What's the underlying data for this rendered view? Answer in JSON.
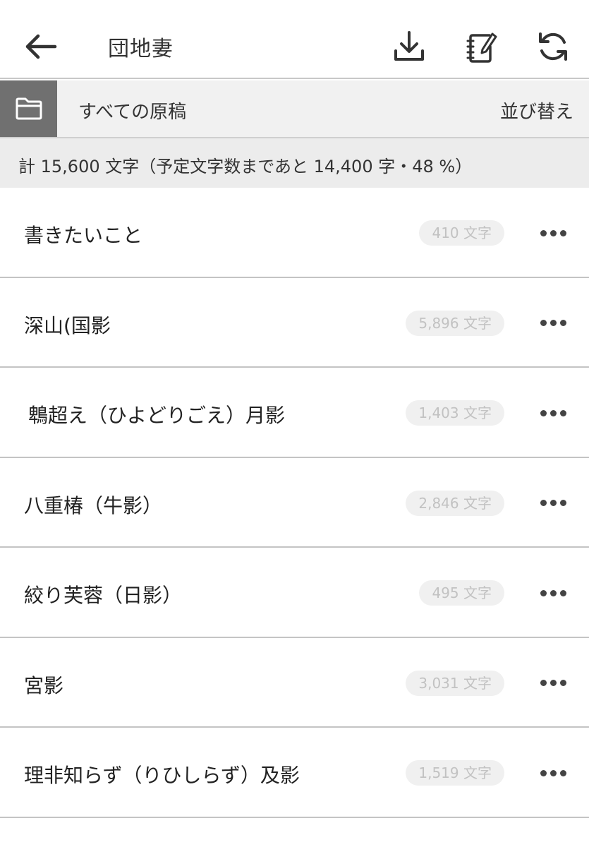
{
  "header": {
    "title": "団地妻",
    "back_icon": "arrow-left-icon",
    "download_icon": "download-icon",
    "notebook_icon": "notebook-edit-icon",
    "sync_icon": "sync-icon"
  },
  "folder_bar": {
    "icon": "folder-icon",
    "label": "すべての原稿",
    "sort_label": "並び替え"
  },
  "summary": {
    "text": "計 15,600 文字（予定文字数まであと 14,400 字・48 %）"
  },
  "manuscripts": [
    {
      "title": "書きたいこと",
      "count": "410 文字"
    },
    {
      "title": "深山(国影",
      "count": "5,896 文字"
    },
    {
      "title": "鵯超え（ひよどりごえ）月影",
      "count": "1,403 文字"
    },
    {
      "title": "八重椿（牛影）",
      "count": "2,846 文字"
    },
    {
      "title": "絞り芙蓉（日影）",
      "count": "495 文字"
    },
    {
      "title": "宮影",
      "count": "3,031 文字"
    },
    {
      "title": "理非知らず（りひしらず）及影",
      "count": "1,519 文字"
    }
  ],
  "colors": {
    "folder_box": "#707070",
    "count_pill_bg": "#f0f0f0",
    "count_pill_text": "#c2c2c2",
    "folder_bar_bg": "#f1f1f1",
    "summary_bg": "#ececec"
  }
}
